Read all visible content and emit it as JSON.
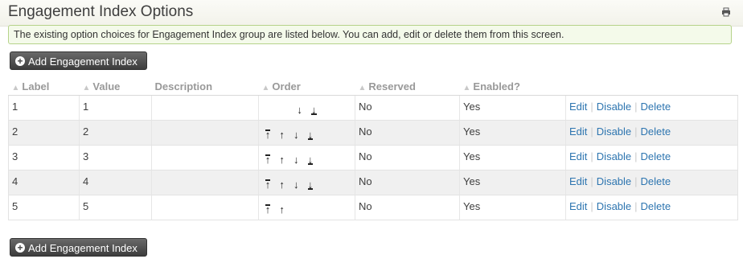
{
  "page": {
    "title": "Engagement Index Options",
    "help_text": "The existing option choices for Engagement Index group are listed below. You can add, edit or delete them from this screen.",
    "add_button_label": "Add Engagement Index"
  },
  "table": {
    "columns": [
      "Label",
      "Value",
      "Description",
      "Order",
      "Reserved",
      "Enabled?"
    ],
    "rows": [
      {
        "label": "1",
        "value": "1",
        "description": "",
        "reserved": "No",
        "enabled": "Yes"
      },
      {
        "label": "2",
        "value": "2",
        "description": "",
        "reserved": "No",
        "enabled": "Yes"
      },
      {
        "label": "3",
        "value": "3",
        "description": "",
        "reserved": "No",
        "enabled": "Yes"
      },
      {
        "label": "4",
        "value": "4",
        "description": "",
        "reserved": "No",
        "enabled": "Yes"
      },
      {
        "label": "5",
        "value": "5",
        "description": "",
        "reserved": "No",
        "enabled": "Yes"
      }
    ],
    "actions": {
      "edit": "Edit",
      "disable": "Disable",
      "delete": "Delete"
    },
    "order_icons": [
      "move-top-icon",
      "move-up-icon",
      "move-down-icon",
      "move-bottom-icon"
    ]
  },
  "colors": {
    "link": "#2d75b0",
    "help_border": "#b6d38a",
    "help_bg": "#f4faea",
    "button": "#4a4a4a"
  }
}
